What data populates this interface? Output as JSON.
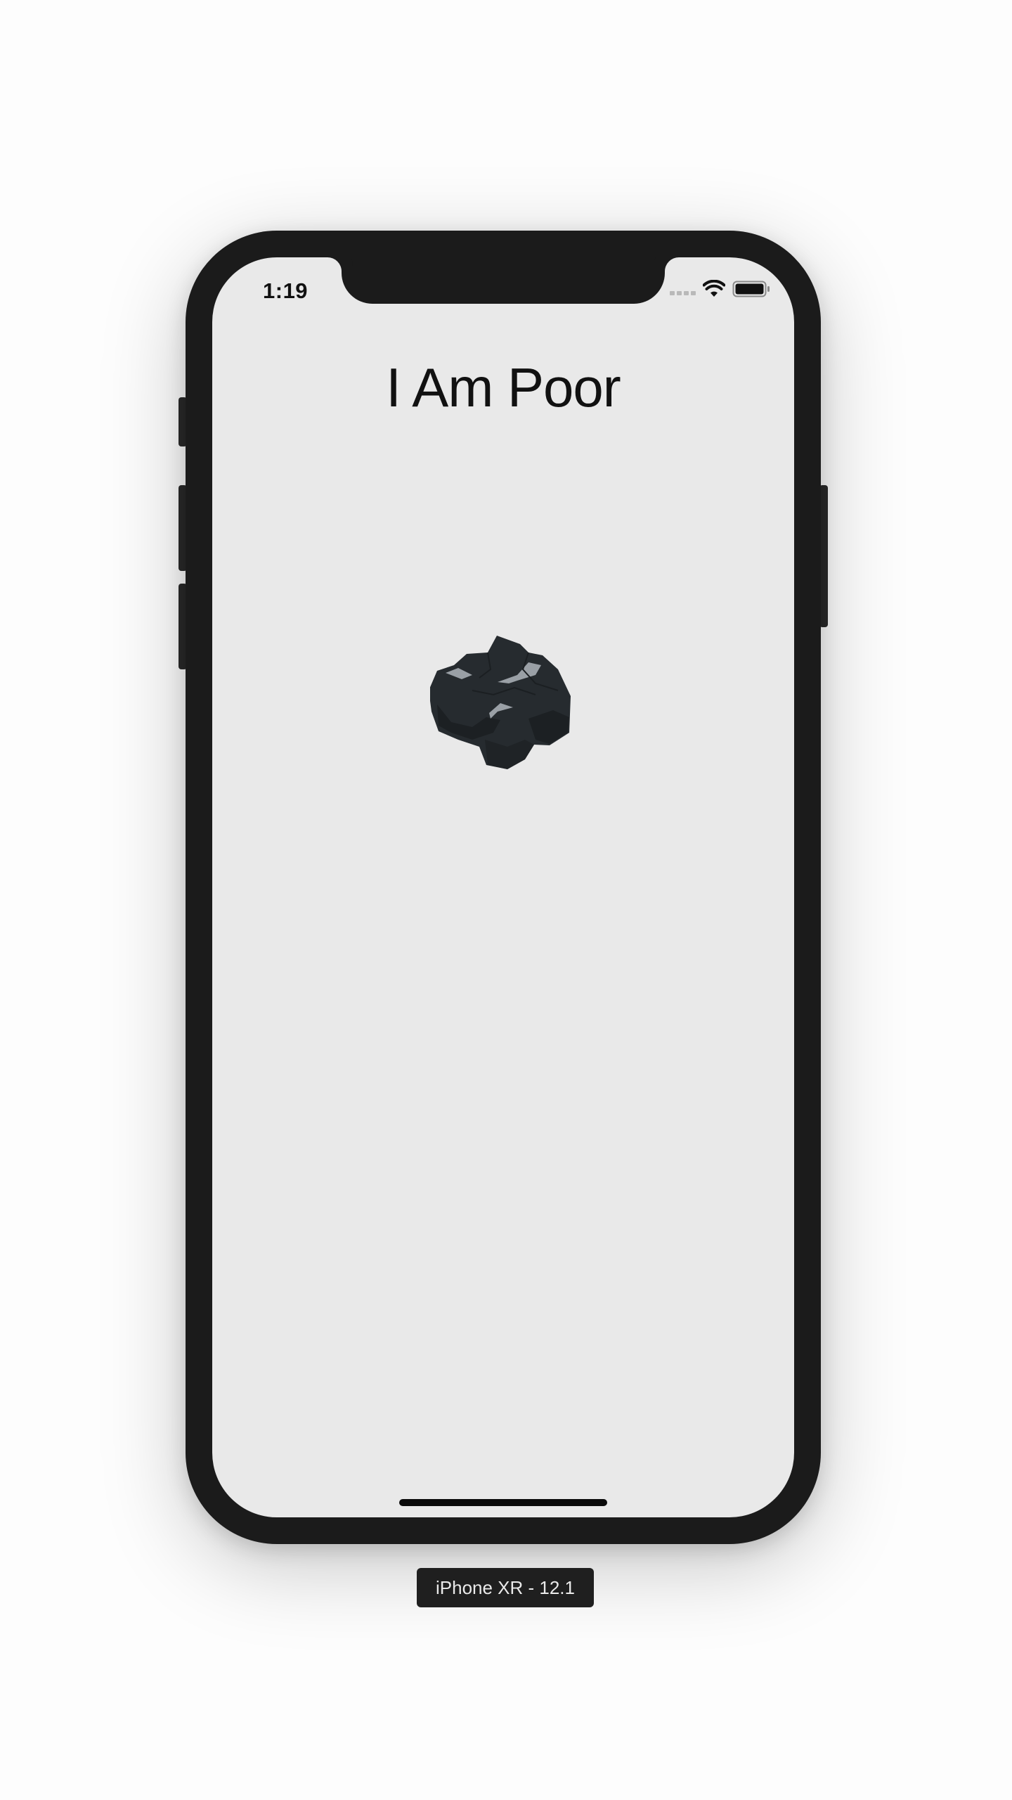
{
  "status_bar": {
    "time": "1:19",
    "icons": [
      "cellular-signal-icon",
      "wifi-icon",
      "battery-icon"
    ]
  },
  "app": {
    "title": "I Am Poor",
    "image": "coal-icon"
  },
  "device_label": "iPhone XR - 12.1",
  "colors": {
    "screen_bg": "#e9e9e9",
    "phone_frame": "#1b1b1b",
    "coal_dark": "#262b2f",
    "coal_highlight": "#9aa0a6"
  }
}
